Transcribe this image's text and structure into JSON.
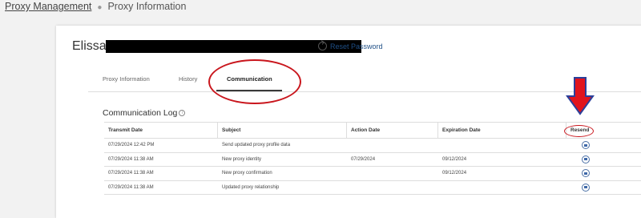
{
  "breadcrumb": {
    "root": "Proxy Management",
    "current": "Proxy Information"
  },
  "profile": {
    "first_name": "Elissa",
    "reset_password": "Reset Password"
  },
  "tabs": [
    {
      "label": "Proxy Information"
    },
    {
      "label": "History"
    },
    {
      "label": "Communication"
    }
  ],
  "log": {
    "title": "Communication Log",
    "columns": [
      "Transmit Date",
      "Subject",
      "Action Date",
      "Expiration Date",
      "Resend"
    ],
    "rows": [
      {
        "transmit": "07/29/2024 12:42 PM",
        "subject": "Send updated proxy profile data",
        "action": "",
        "expiration": ""
      },
      {
        "transmit": "07/29/2024 11:38 AM",
        "subject": "New proxy identity",
        "action": "07/29/2024",
        "expiration": "09/12/2024"
      },
      {
        "transmit": "07/29/2024 11:38 AM",
        "subject": "New proxy confirmation",
        "action": "",
        "expiration": "09/12/2024"
      },
      {
        "transmit": "07/29/2024 11:38 AM",
        "subject": "Updated proxy relationship",
        "action": "",
        "expiration": ""
      }
    ]
  },
  "colors": {
    "annotation_red": "#c9161d",
    "arrow_blue": "#2b3f9a",
    "link_blue": "#1f4f86"
  }
}
